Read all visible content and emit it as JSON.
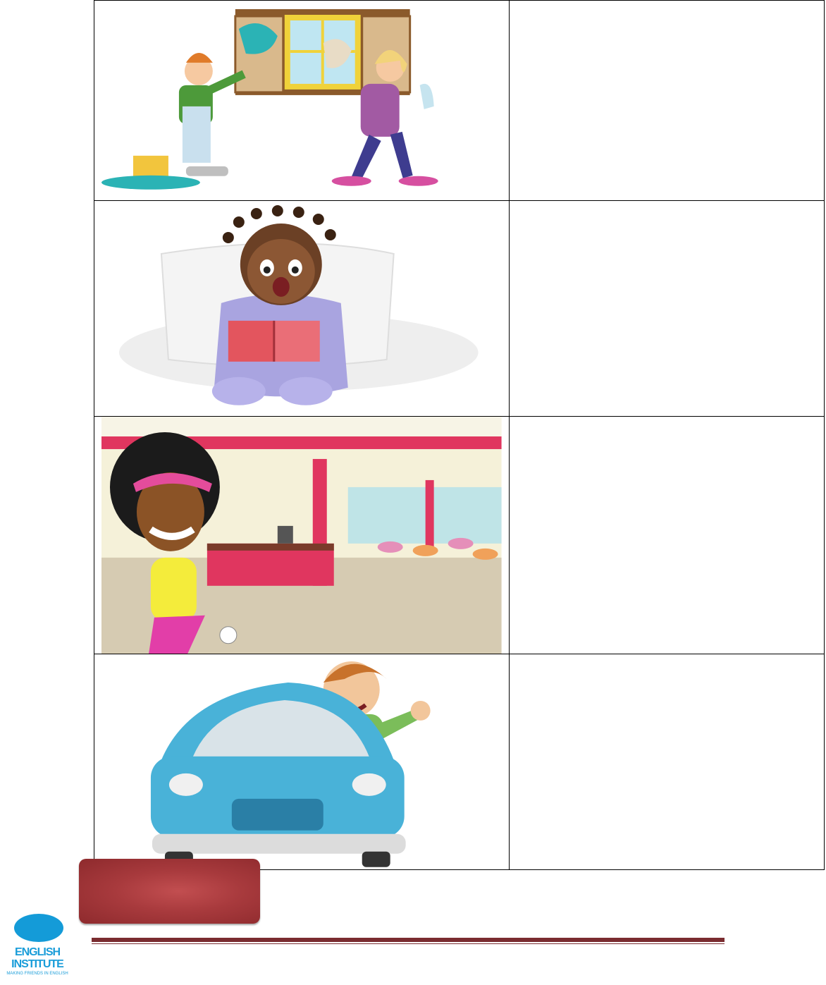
{
  "logo": {
    "line1": "ENGLISH",
    "line2": "INSTITUTE",
    "tagline": "MAKING FRIENDS IN ENGLISH"
  },
  "rows": [
    {
      "scene": "children-cleaning-window",
      "answer": ""
    },
    {
      "scene": "girl-crying-reading-book",
      "answer": ""
    },
    {
      "scene": "woman-embarrassed-restaurant",
      "answer": ""
    },
    {
      "scene": "angry-man-driving-car",
      "answer": ""
    }
  ],
  "colors": {
    "tab": "#a83a3d",
    "rule": "#7a2c30",
    "logo_blue": "#149bd8"
  }
}
